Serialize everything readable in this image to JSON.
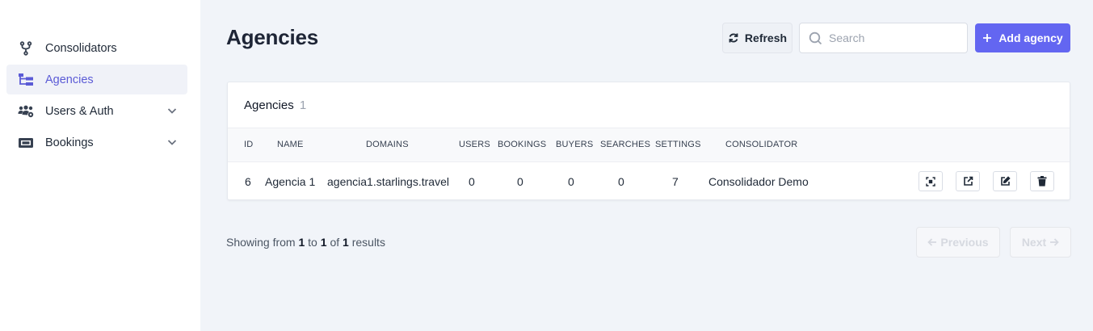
{
  "sidebar": {
    "items": [
      {
        "label": "Consolidators",
        "icon": "fork-icon",
        "active": false
      },
      {
        "label": "Agencies",
        "icon": "hierarchy-icon",
        "active": true
      },
      {
        "label": "Users & Auth",
        "icon": "users-gear-icon",
        "active": false,
        "expandable": true
      },
      {
        "label": "Bookings",
        "icon": "ticket-icon",
        "active": false,
        "expandable": true
      }
    ]
  },
  "header": {
    "title": "Agencies",
    "refresh_label": "Refresh",
    "search_placeholder": "Search",
    "add_label": "Add agency"
  },
  "table": {
    "title": "Agencies",
    "count": "1",
    "columns": [
      "ID",
      "NAME",
      "DOMAINS",
      "USERS",
      "BOOKINGS",
      "BUYERS",
      "SEARCHES",
      "SETTINGS",
      "CONSOLIDATOR"
    ],
    "rows": [
      {
        "id": "6",
        "name": "Agencia 1",
        "domains": "agencia1.starlings.travel",
        "users": "0",
        "bookings": "0",
        "buyers": "0",
        "searches": "0",
        "settings": "7",
        "consolidator": "Consolidador Demo"
      }
    ],
    "row_actions": [
      "scan-icon",
      "external-link-icon",
      "edit-icon",
      "trash-icon"
    ]
  },
  "pagination": {
    "showing_prefix": "Showing from",
    "from": "1",
    "to_word": "to",
    "to": "1",
    "of_word": "of",
    "total": "1",
    "results_word": "results",
    "previous_label": "Previous",
    "next_label": "Next"
  },
  "colors": {
    "accent": "#6366f1",
    "active_text": "#5b5bd6",
    "active_bg": "#f0f2f8",
    "page_bg": "#f1f4f9"
  }
}
